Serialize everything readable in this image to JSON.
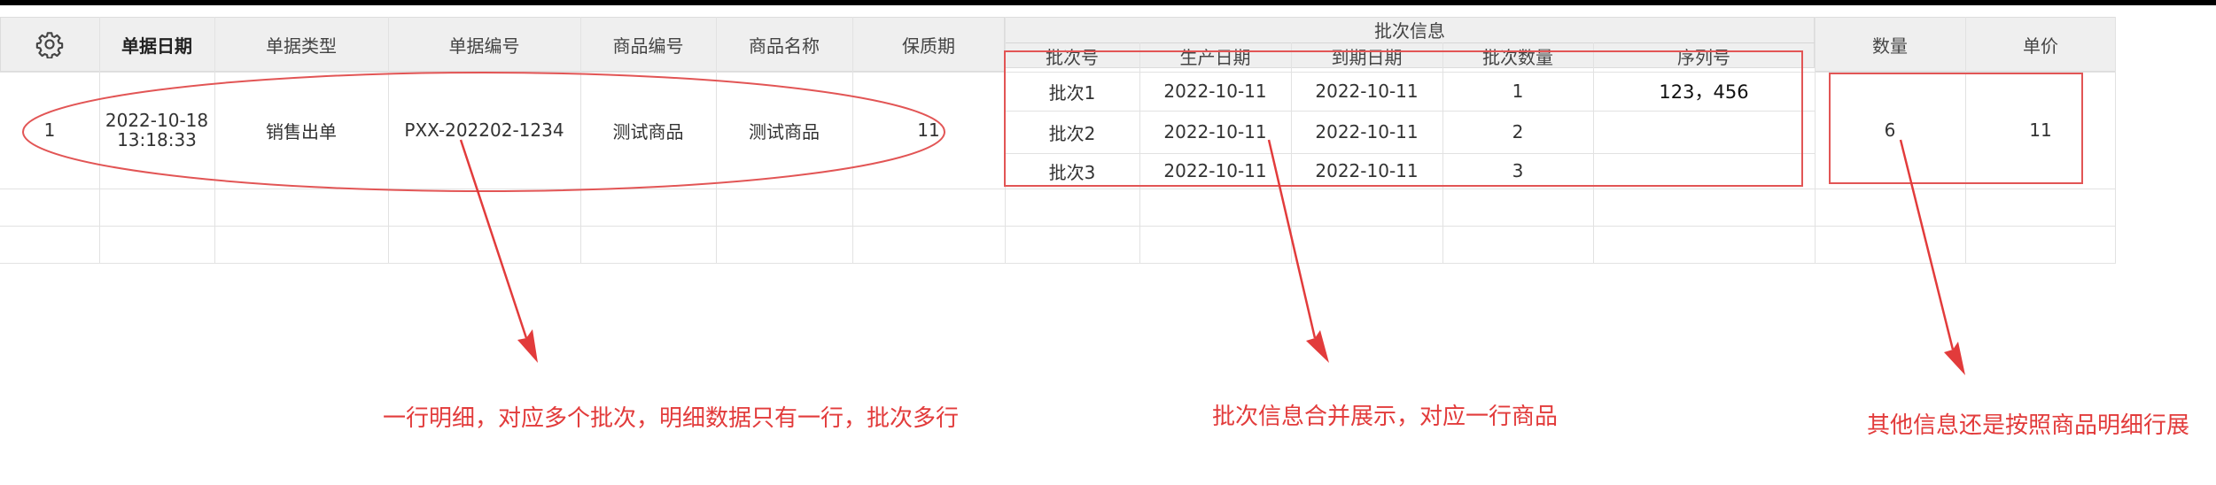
{
  "table": {
    "settings_icon": "gear-icon",
    "headers": {
      "date": "单据日期",
      "type": "单据类型",
      "number": "单据编号",
      "product_code": "商品编号",
      "product_name": "商品名称",
      "shelf_life": "保质期",
      "batch_group": "批次信息",
      "batch_no": "批次号",
      "mfg_date": "生产日期",
      "exp_date": "到期日期",
      "batch_qty": "批次数量",
      "serial_no": "序列号",
      "quantity": "数量",
      "unit_price": "单价"
    },
    "row": {
      "index": "1",
      "date": "2022-10-18",
      "time": "13:18:33",
      "type": "销售出单",
      "number": "PXX-202202-1234",
      "product_code": "测试商品",
      "product_name": "测试商品",
      "shelf_life": "11",
      "quantity": "6",
      "unit_price": "11"
    },
    "batches": [
      {
        "batch_no": "批次1",
        "mfg_date": "2022-10-11",
        "exp_date": "2022-10-11",
        "qty": "1",
        "serial": "123，456"
      },
      {
        "batch_no": "批次2",
        "mfg_date": "2022-10-11",
        "exp_date": "2022-10-11",
        "qty": "2",
        "serial": ""
      },
      {
        "batch_no": "批次3",
        "mfg_date": "2022-10-11",
        "exp_date": "2022-10-11",
        "qty": "3",
        "serial": ""
      }
    ]
  },
  "annotations": {
    "detail_note": "一行明细，对应多个批次，明细数据只有一行，批次多行",
    "batch_note": "批次信息合并展示，对应一行商品",
    "other_note": "其他信息还是按照商品明细行展",
    "color": "#e23b3b"
  }
}
